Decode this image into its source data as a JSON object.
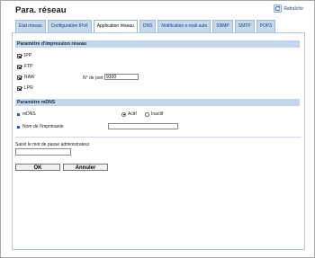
{
  "page_title": "Para. réseau",
  "refresh": {
    "label": "Rafraîchir",
    "icon": "refresh-icon"
  },
  "tabs": [
    {
      "label": "Etat réseau",
      "active": false
    },
    {
      "label": "Configuration IPv6",
      "active": false
    },
    {
      "label": "Application réseau",
      "active": true
    },
    {
      "label": "DNS",
      "active": false
    },
    {
      "label": "Notification e-mail auto",
      "active": false
    },
    {
      "label": "SNMP",
      "active": false
    },
    {
      "label": "SMTP",
      "active": false
    },
    {
      "label": "POP3",
      "active": false
    }
  ],
  "print_settings": {
    "header": "Paramètre d'impression réseau",
    "ipp": {
      "label": "IPP",
      "checked": true
    },
    "ftp": {
      "label": "FTP",
      "checked": true
    },
    "raw": {
      "label": "RAW",
      "checked": true
    },
    "lpr": {
      "label": "LPR",
      "checked": true
    },
    "port_label": "N° de port",
    "port_value": "9100"
  },
  "mdns": {
    "header": "Paramètre mDNS",
    "mdns_label": "mDNS",
    "active_label": "Actif",
    "inactive_label": "Inactif",
    "active_selected": true,
    "printer_name_label": "Nom de l'imprimante",
    "printer_name_value": ""
  },
  "admin": {
    "label": "Saisir le mot de passe administrateur",
    "value": ""
  },
  "buttons": {
    "ok": "OK",
    "cancel": "Annuler"
  },
  "colors": {
    "accent": "#1f3c7a",
    "tab_bg": "#c5d8ec",
    "section_bg": "#c5d6ea",
    "bullet": "#1f5fbf"
  }
}
